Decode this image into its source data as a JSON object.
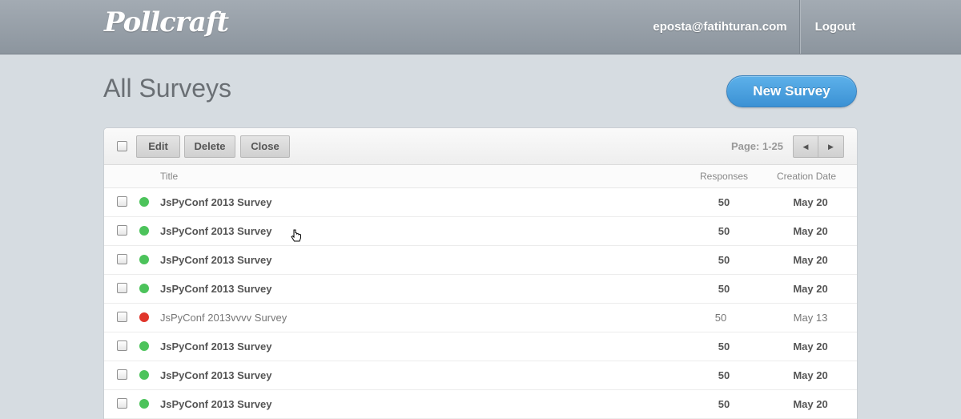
{
  "header": {
    "logo": "Pollcraft",
    "user_email": "eposta@fatihturan.com",
    "logout_label": "Logout"
  },
  "page": {
    "title": "All Surveys",
    "new_survey_label": "New Survey"
  },
  "toolbar": {
    "edit_label": "Edit",
    "delete_label": "Delete",
    "close_label": "Close",
    "page_info": "Page: 1-25",
    "prev_icon": "◀",
    "next_icon": "▶"
  },
  "columns": {
    "title": "Title",
    "responses": "Responses",
    "date": "Creation Date"
  },
  "colors": {
    "active": "#4cc35b",
    "closed": "#e0352b",
    "accent": "#3b91d4"
  },
  "surveys": [
    {
      "title": "JsPyConf 2013 Survey",
      "responses": "50",
      "date": "May 20",
      "status": "active"
    },
    {
      "title": "JsPyConf 2013 Survey",
      "responses": "50",
      "date": "May 20",
      "status": "active"
    },
    {
      "title": "JsPyConf 2013 Survey",
      "responses": "50",
      "date": "May 20",
      "status": "active"
    },
    {
      "title": "JsPyConf 2013 Survey",
      "responses": "50",
      "date": "May 20",
      "status": "active"
    },
    {
      "title": "JsPyConf 2013vvvv Survey",
      "responses": "50",
      "date": "May 13",
      "status": "closed"
    },
    {
      "title": "JsPyConf 2013 Survey",
      "responses": "50",
      "date": "May 20",
      "status": "active"
    },
    {
      "title": "JsPyConf 2013 Survey",
      "responses": "50",
      "date": "May 20",
      "status": "active"
    },
    {
      "title": "JsPyConf 2013 Survey",
      "responses": "50",
      "date": "May 20",
      "status": "active"
    }
  ]
}
